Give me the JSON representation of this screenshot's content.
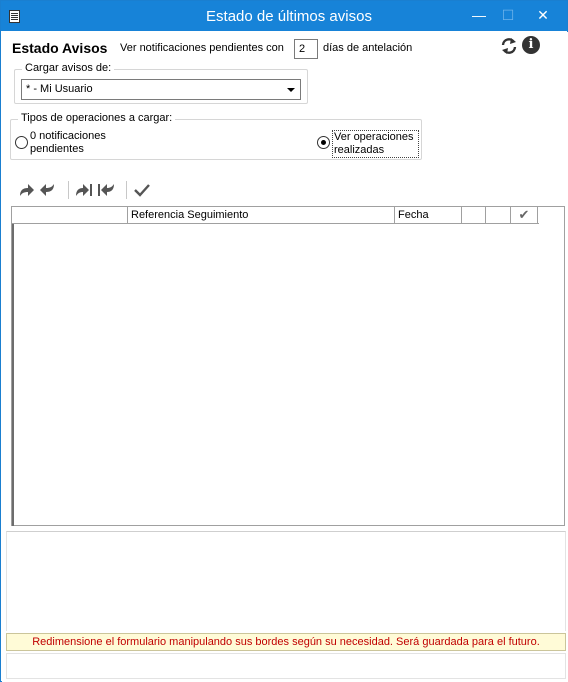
{
  "window": {
    "title": "Estado de últimos avisos",
    "controls": {
      "minimize": "—",
      "maximize": "☐",
      "close": "✕"
    }
  },
  "header": {
    "title": "Estado Avisos",
    "days_prefix": "Ver notificaciones pendientes con",
    "days_value": "2",
    "days_suffix": "días de antelación",
    "icons": [
      "refresh-icon",
      "info-icon"
    ],
    "info_glyph": "i"
  },
  "load_from": {
    "legend": "Cargar avisos de:",
    "selected": "* - Mi Usuario"
  },
  "operation_types": {
    "legend": "Tipos de operaciones a cargar:",
    "options": [
      {
        "label": "0 notificaciones pendientes",
        "checked": false
      },
      {
        "label": "Ver operaciones realizadas",
        "checked": true
      }
    ]
  },
  "toolbar": {
    "icons": [
      "forward-icon",
      "reply-icon",
      "forward-all-icon",
      "reply-all-icon",
      "check-icon"
    ]
  },
  "table": {
    "columns": [
      "",
      "Referencia Seguimiento",
      "Fecha",
      "",
      "",
      "✔"
    ],
    "rows": []
  },
  "status_message": "Redimensione el formulario manipulando sus bordes según su necesidad. Será guardada para el futuro.",
  "colors": {
    "titlebar": "#1783d8",
    "status_bg": "#fffbd7",
    "status_text": "#c00000"
  }
}
